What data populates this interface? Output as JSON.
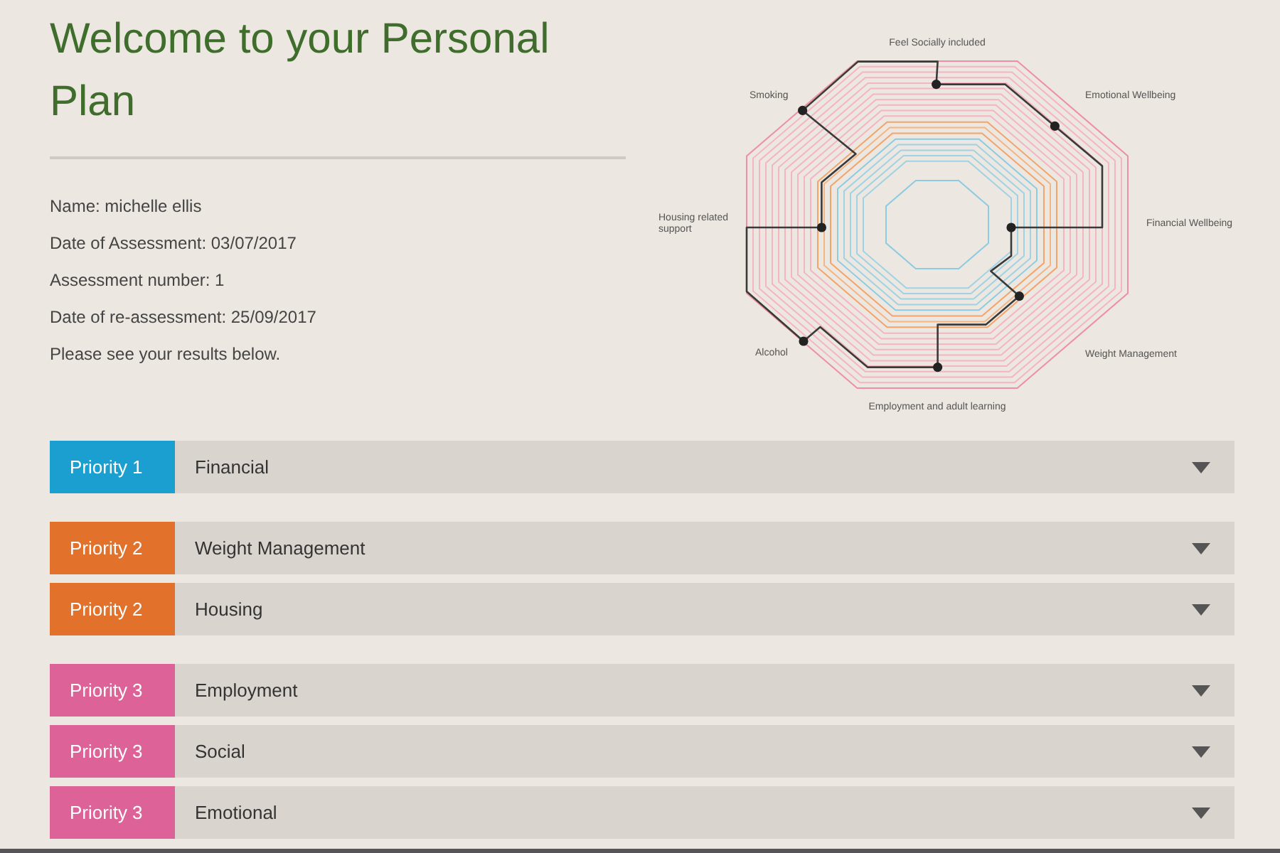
{
  "page": {
    "title": "Welcome to your Personal Plan"
  },
  "details": [
    "Name: michelle ellis",
    "Date of Assessment: 03/07/2017",
    "Assessment number: 1",
    "Date of re-assessment: 25/09/2017",
    "Please see your results below."
  ],
  "wellbeing_chart": {
    "axis_labels": [
      "Feel Socially included",
      "Smoking",
      "Emotional Wellbeing",
      "Housing related support",
      "Financial Wellbeing",
      "Alcohol",
      "Weight Management",
      "Employment and adult learning"
    ]
  },
  "priority_groups": [
    {
      "items": [
        {
          "badge": "Priority 1",
          "color": "#1b9fd1",
          "title": "Financial",
          "expanded": false
        }
      ]
    },
    {
      "items": [
        {
          "badge": "Priority 2",
          "color": "#e2712b",
          "title": "Weight Management",
          "expanded": false
        },
        {
          "badge": "Priority 2",
          "color": "#e2712b",
          "title": "Housing",
          "expanded": false
        }
      ]
    },
    {
      "items": [
        {
          "badge": "Priority 3",
          "color": "#dd6297",
          "title": "Employment",
          "expanded": false
        },
        {
          "badge": "Priority 3",
          "color": "#dd6297",
          "title": "Social",
          "expanded": false
        },
        {
          "badge": "Priority 3",
          "color": "#dd6297",
          "title": "Emotional",
          "expanded": false
        }
      ]
    }
  ]
}
